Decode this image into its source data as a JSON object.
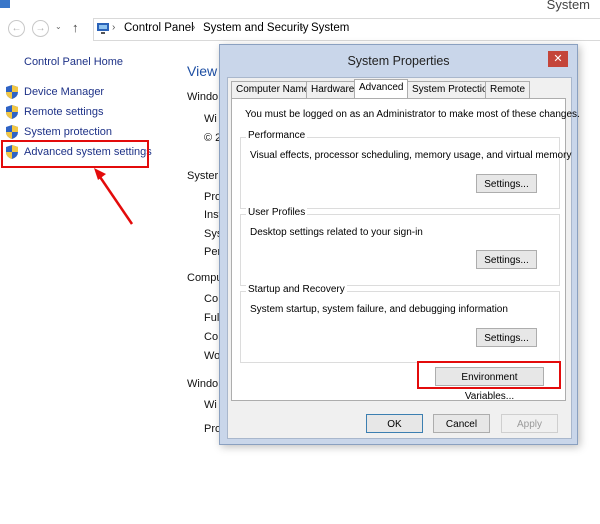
{
  "window": {
    "title": "System"
  },
  "breadcrumb": {
    "items": [
      "Control Panel",
      "System and Security",
      "System"
    ]
  },
  "left_pane": {
    "home": "Control Panel Home",
    "items": [
      "Device Manager",
      "Remote settings",
      "System protection",
      "Advanced system settings"
    ]
  },
  "main_behind": {
    "view": "View",
    "fragments": [
      "Windo",
      "Wi",
      "© 2",
      "Syster",
      "Pro",
      "Inst",
      "Sys",
      "Per",
      "Compu",
      "Co",
      "Ful",
      "Co",
      "Wo",
      "Windo",
      "Wi",
      "Pro"
    ]
  },
  "dialog": {
    "title": "System Properties",
    "close": "✕",
    "tabs": [
      "Computer Name",
      "Hardware",
      "Advanced",
      "System Protection",
      "Remote"
    ],
    "notice": "You must be logged on as an Administrator to make most of these changes.",
    "performance": {
      "title": "Performance",
      "desc": "Visual effects, processor scheduling, memory usage, and virtual memory",
      "button": "Settings..."
    },
    "user_profiles": {
      "title": "User Profiles",
      "desc": "Desktop settings related to your sign-in",
      "button": "Settings..."
    },
    "startup": {
      "title": "Startup and Recovery",
      "desc": "System startup, system failure, and debugging information",
      "button": "Settings..."
    },
    "env_button": "Environment Variables...",
    "ok": "OK",
    "cancel": "Cancel",
    "apply": "Apply"
  },
  "colors": {
    "highlight": "#e30b0b",
    "link": "#1e3287",
    "dialog_frame": "#c9d6ea"
  }
}
